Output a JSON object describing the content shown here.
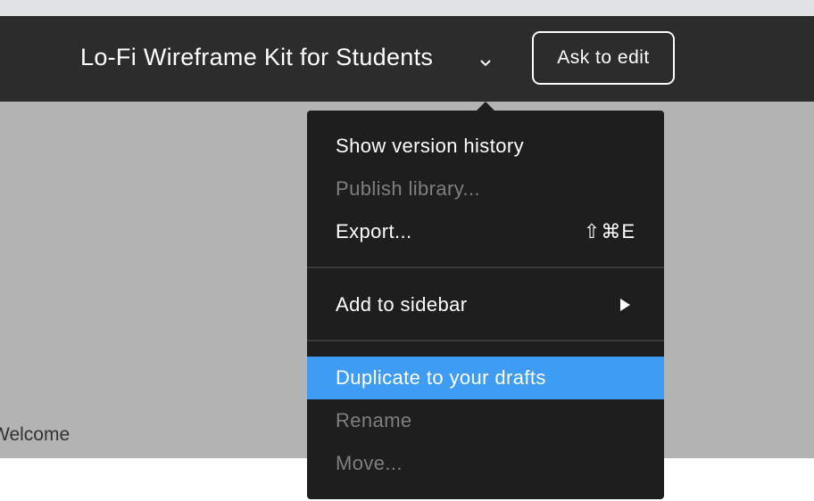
{
  "header": {
    "file_title": "Lo-Fi Wireframe Kit for Students",
    "chevron_icon": "chevron-down-icon",
    "ask_to_edit_label": "Ask to edit"
  },
  "canvas": {
    "welcome_label": "Welcome"
  },
  "menu": {
    "show_version_history": "Show version history",
    "publish_library": "Publish library...",
    "export": "Export...",
    "export_shortcut": "⇧⌘E",
    "add_to_sidebar": "Add to sidebar",
    "submenu_icon": "submenu-arrow-icon",
    "duplicate_to_drafts": "Duplicate to your drafts",
    "rename": "Rename",
    "move": "Move..."
  },
  "colors": {
    "header_bg": "#2c2c2c",
    "canvas_bg": "#b3b3b3",
    "menu_bg": "#1e1e1e",
    "highlight": "#3e9cf5",
    "disabled_text": "#7f7f7f"
  }
}
